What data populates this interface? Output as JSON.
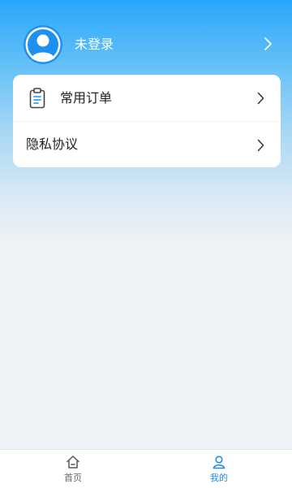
{
  "profile": {
    "name": "未登录",
    "avatar_icon": "avatar-icon",
    "chevron_icon": "chevron-right-icon"
  },
  "menu": {
    "items": [
      {
        "label": "常用订单",
        "icon": "clipboard-icon"
      },
      {
        "label": "隐私协议"
      }
    ]
  },
  "tabbar": {
    "tabs": [
      {
        "label": "首页",
        "icon": "home-icon",
        "active": false
      },
      {
        "label": "我的",
        "icon": "user-icon",
        "active": true
      }
    ]
  },
  "colors": {
    "brand_blue": "#28a7fb",
    "active_tab": "#1f8be8",
    "inactive_tab": "#666666",
    "page_background": "#eff2f6"
  }
}
